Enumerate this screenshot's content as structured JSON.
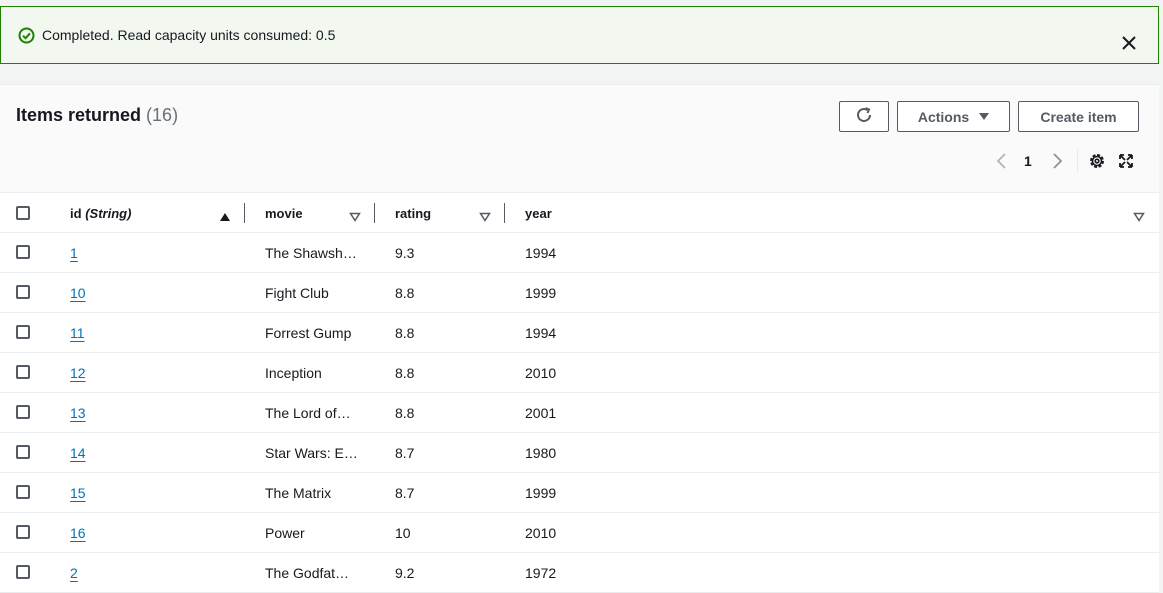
{
  "flash": {
    "message": "Completed. Read capacity units consumed: 0.5",
    "status_color": "#1d8102"
  },
  "header": {
    "title": "Items returned",
    "count": "(16)",
    "actions_label": "Actions",
    "create_label": "Create item"
  },
  "pagination": {
    "current_page": "1"
  },
  "table": {
    "columns": [
      {
        "label": "id",
        "type_label": "(String)"
      },
      {
        "label": "movie"
      },
      {
        "label": "rating"
      },
      {
        "label": "year"
      }
    ],
    "rows": [
      {
        "id": "1",
        "movie": "The Shawsh…",
        "rating": "9.3",
        "year": "1994"
      },
      {
        "id": "10",
        "movie": "Fight Club",
        "rating": "8.8",
        "year": "1999"
      },
      {
        "id": "11",
        "movie": "Forrest Gump",
        "rating": "8.8",
        "year": "1994"
      },
      {
        "id": "12",
        "movie": "Inception",
        "rating": "8.8",
        "year": "2010"
      },
      {
        "id": "13",
        "movie": "The Lord of…",
        "rating": "8.8",
        "year": "2001"
      },
      {
        "id": "14",
        "movie": "Star Wars: E…",
        "rating": "8.7",
        "year": "1980"
      },
      {
        "id": "15",
        "movie": "The Matrix",
        "rating": "8.7",
        "year": "1999"
      },
      {
        "id": "16",
        "movie": "Power",
        "rating": "10",
        "year": "2010"
      },
      {
        "id": "2",
        "movie": "The Godfat…",
        "rating": "9.2",
        "year": "1972"
      }
    ]
  },
  "colors": {
    "link": "#0073bb",
    "button_border": "#545b64",
    "success_bg": "#f2f8f0"
  },
  "icons": {
    "flash": "check-circle-icon",
    "close": "close-icon",
    "refresh": "refresh-icon",
    "prev": "chevron-left-icon",
    "next": "chevron-right-icon",
    "settings": "gear-icon",
    "fullscreen": "fullscreen-icon"
  }
}
